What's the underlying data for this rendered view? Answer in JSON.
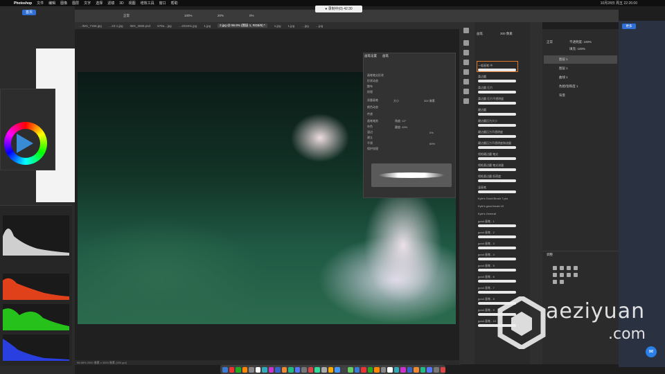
{
  "menubar": {
    "app_name": "Photoshop",
    "items": [
      "文件",
      "编辑",
      "图像",
      "图层",
      "文字",
      "选择",
      "滤镜",
      "3D",
      "视图",
      "增效工具",
      "窗口",
      "帮助"
    ],
    "right_status": "10月28日 周五 22:26:00"
  },
  "recording_timer": "● 录制中(0) 42:30",
  "left_app": {
    "tab_label": "首页"
  },
  "toolbar": {
    "mode_label": "正常",
    "opacity": "100%",
    "flow": "20%",
    "smoothing": "0%"
  },
  "doc_tabs": [
    "…IMG_7156.jpg",
    "…23-1.jpg",
    "IMG_3666.psd",
    "678a…jpg",
    "…203401.jpg",
    "1.jpg",
    "2.jpg @ 96.9% (图层 1, RGB/8) *",
    "1.jpg",
    "1.jpg",
    "…jpg",
    "…jpg"
  ],
  "canvas_status": "96.88%  2000 像素 x 3000 像素 (300 ppi)",
  "brush_settings": {
    "tabs": [
      "画笔设置",
      "画笔"
    ],
    "options": [
      "画笔笔尖形状",
      "形状动态",
      "散布",
      "纹理",
      "双重画笔",
      "颜色动态",
      "传递",
      "画笔笔势",
      "杂色",
      "湿边",
      "建立",
      "平滑",
      "保护纹理"
    ],
    "size_label": "大小",
    "size_value": "300 像素",
    "angle_label": "角度: 12°",
    "roundness_label": "圆度: 45%",
    "hardness": "0%",
    "spacing": "69%"
  },
  "brushes_panel": {
    "title": "画笔",
    "size_value": "300 像素",
    "items": [
      "一般画笔 中",
      "柔边圆",
      "柔边圆 压力",
      "柔边圆 压力不透明度",
      "硬边圆",
      "硬边圆压力大小",
      "硬边圆压力不透明度",
      "硬边圆压力不透明度和流量",
      "喷枪硬边圆 笔尖",
      "喷枪柔边圆 笔尖流量",
      "喷枪柔边圆 低密度",
      "湿画笔",
      "Kyle's Good Brush 7.pro",
      "Kyle's good brush 10",
      "Kyle's General",
      "good 画笔 - 1",
      "good 画笔 - 2",
      "good 画笔 - 3",
      "good 画笔 - 4",
      "good 画笔 - 5",
      "good 画笔 - 6",
      "good 画笔 - 7",
      "good 画笔 - 8",
      "good 画笔 - 9",
      "good 画笔 - 10"
    ]
  },
  "layers_panel": {
    "blend_mode": "正常",
    "opacity": "不透明度: 100%",
    "fill": "填充: 100%",
    "layers": [
      "图层 1",
      "图层 1",
      "曲线 1",
      "色相/饱和度 1",
      "背景"
    ]
  },
  "adjustments_panel": {
    "title": "调整"
  },
  "right_app": {
    "button_label": "更多"
  },
  "watermark": {
    "line1": "aeziyuan",
    "line2": ".com"
  },
  "colors": {
    "accent": "#2f6fd6",
    "selection_border": "#e07b2b",
    "hist_red": "#e0401a",
    "hist_green": "#26c21b",
    "hist_blue": "#2a3fe0"
  }
}
